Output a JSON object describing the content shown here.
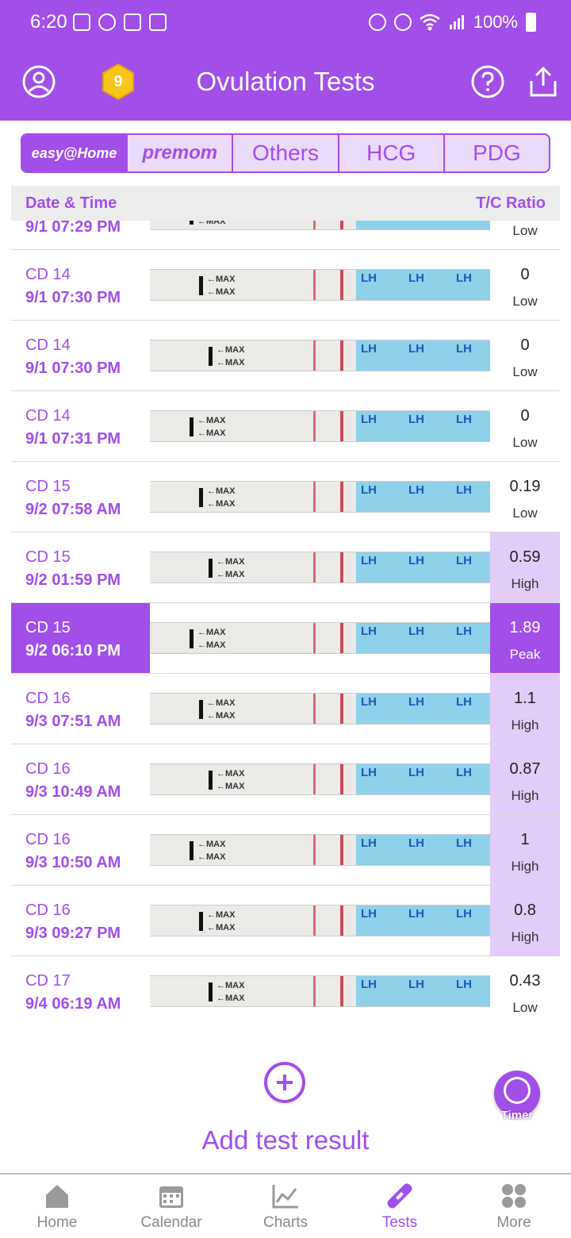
{
  "status": {
    "time": "6:20",
    "battery": "100%"
  },
  "header": {
    "title": "Ovulation Tests",
    "coin_count": "9"
  },
  "tabs": [
    {
      "label": "easy@Home"
    },
    {
      "label": "premom"
    },
    {
      "label": "Others"
    },
    {
      "label": "HCG"
    },
    {
      "label": "PDG"
    }
  ],
  "table": {
    "col_date": "Date & Time",
    "col_ratio": "T/C Ratio",
    "rows": [
      {
        "cd": "",
        "datetime": "9/1  07:29 PM",
        "ratio": "",
        "level": "Low"
      },
      {
        "cd": "CD 14",
        "datetime": "9/1  07:30 PM",
        "ratio": "0",
        "level": "Low"
      },
      {
        "cd": "CD 14",
        "datetime": "9/1  07:30 PM",
        "ratio": "0",
        "level": "Low"
      },
      {
        "cd": "CD 14",
        "datetime": "9/1  07:31 PM",
        "ratio": "0",
        "level": "Low"
      },
      {
        "cd": "CD 15",
        "datetime": "9/2  07:58 AM",
        "ratio": "0.19",
        "level": "Low"
      },
      {
        "cd": "CD 15",
        "datetime": "9/2  01:59 PM",
        "ratio": "0.59",
        "level": "High"
      },
      {
        "cd": "CD 15",
        "datetime": "9/2  06:10 PM",
        "ratio": "1.89",
        "level": "Peak"
      },
      {
        "cd": "CD 16",
        "datetime": "9/3  07:51 AM",
        "ratio": "1.1",
        "level": "High"
      },
      {
        "cd": "CD 16",
        "datetime": "9/3  10:49 AM",
        "ratio": "0.87",
        "level": "High"
      },
      {
        "cd": "CD 16",
        "datetime": "9/3  10:50 AM",
        "ratio": "1",
        "level": "High"
      },
      {
        "cd": "CD 16",
        "datetime": "9/3  09:27 PM",
        "ratio": "0.8",
        "level": "High"
      },
      {
        "cd": "CD 17",
        "datetime": "9/4  06:19 AM",
        "ratio": "0.43",
        "level": "Low"
      }
    ]
  },
  "strip": {
    "max_label": "←MAX",
    "lh_label": "LH"
  },
  "add_result": {
    "label": "Add test result"
  },
  "timer": {
    "label": "Timer"
  },
  "nav": [
    {
      "label": "Home",
      "icon": "home-icon"
    },
    {
      "label": "Calendar",
      "icon": "calendar-icon"
    },
    {
      "label": "Charts",
      "icon": "chart-icon"
    },
    {
      "label": "Tests",
      "icon": "test-strip-icon"
    },
    {
      "label": "More",
      "icon": "more-grid-icon"
    }
  ],
  "colors": {
    "accent": "#a24ee9",
    "high_bg": "#e2ccfa",
    "strip_blue": "#8fd0ea"
  }
}
